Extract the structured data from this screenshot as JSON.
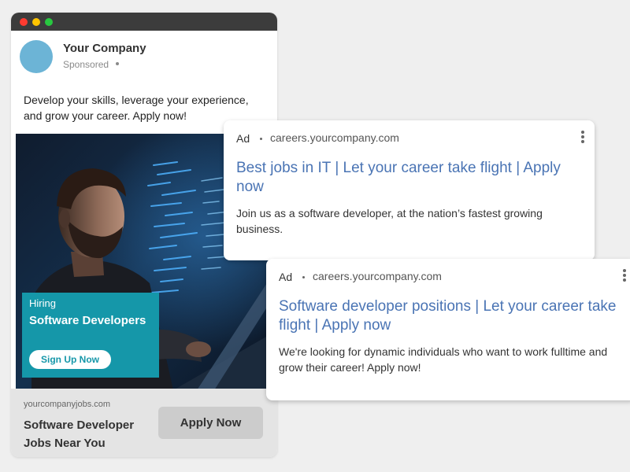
{
  "social_ad": {
    "company_name": "Your Company",
    "sponsored_label": "Sponsored",
    "post_text": "Develop your skills, leverage your experience, and grow your career. Apply now!",
    "image_overlay": {
      "hiring_label": "Hiring",
      "title": "Software Developers",
      "cta_label": "Sign Up Now"
    },
    "footer": {
      "domain": "yourcompanyjobs.com",
      "headline": "Software Developer Jobs Near You",
      "apply_label": "Apply Now"
    }
  },
  "search_ads": [
    {
      "ad_label": "Ad",
      "url": "careers.yourcompany.com",
      "headline": "Best jobs in IT | Let your career take flight | Apply now",
      "description": "Join us as a software developer, at the nation’s fastest growing business."
    },
    {
      "ad_label": "Ad",
      "url": "careers.yourcompany.com",
      "headline": "Software developer positions | Let your career take flight | Apply now",
      "description": "We're looking for dynamic individuals who want to work fulltime and grow their career! Apply now!"
    }
  ],
  "colors": {
    "accent_teal": "#1597a9",
    "link_blue": "#4a74b4",
    "avatar_blue": "#6cb4d6"
  }
}
